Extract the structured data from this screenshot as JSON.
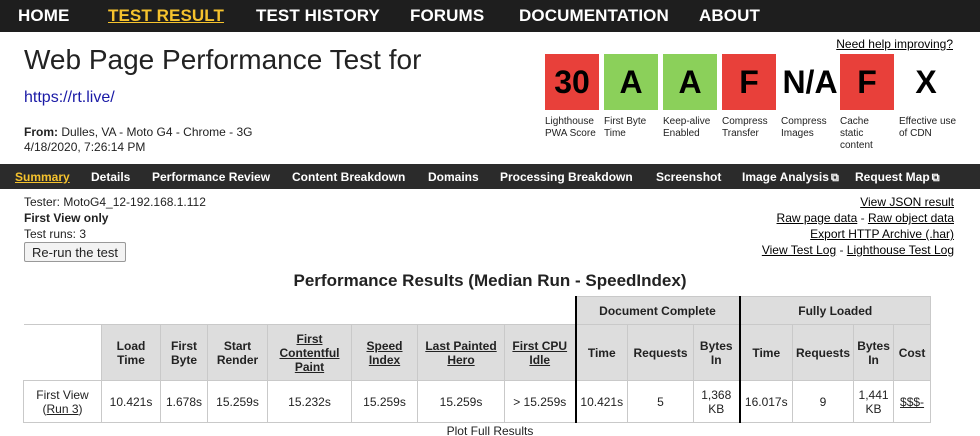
{
  "nav": {
    "items": [
      "HOME",
      "TEST RESULT",
      "TEST HISTORY",
      "FORUMS",
      "DOCUMENTATION",
      "ABOUT"
    ],
    "active": "TEST RESULT"
  },
  "header": {
    "title": "Web Page Performance Test for",
    "url": "https://rt.live/",
    "from_label": "From:",
    "from_value": "Dulles, VA - Moto G4 - Chrome - 3G",
    "date": "4/18/2020, 7:26:14 PM",
    "help_link": "Need help improving?"
  },
  "grades": [
    {
      "value": "30",
      "label": "Lighthouse PWA Score",
      "color": "#e8403a"
    },
    {
      "value": "A",
      "label": "First Byte Time",
      "color": "#8bd05a"
    },
    {
      "value": "A",
      "label": "Keep-alive Enabled",
      "color": "#8bd05a"
    },
    {
      "value": "F",
      "label": "Compress Transfer",
      "color": "#e8403a"
    },
    {
      "value": "N/A",
      "label": "Compress Images",
      "color": "#ffffff"
    },
    {
      "value": "F",
      "label": "Cache static content",
      "color": "#e8403a"
    },
    {
      "value": "X",
      "label": "Effective use of CDN",
      "color": "#ffffff"
    }
  ],
  "subnav": {
    "items": [
      "Summary",
      "Details",
      "Performance Review",
      "Content Breakdown",
      "Domains",
      "Processing Breakdown",
      "Screenshot",
      "Image Analysis",
      "Request Map"
    ],
    "active": "Summary"
  },
  "test_info": {
    "tester": "Tester: MotoG4_12-192.168.1.112",
    "view": "First View only",
    "runs": "Test runs: 3",
    "rerun_button": "Re-run the test"
  },
  "links": {
    "view_json": "View JSON result",
    "raw_page": "Raw page data",
    "raw_object": "Raw object data",
    "export_har": "Export HTTP Archive (.har)",
    "test_log": "View Test Log",
    "lighthouse_log": "Lighthouse Test Log",
    "separator": " - "
  },
  "results": {
    "heading": "Performance Results (Median Run - SpeedIndex)",
    "group_headers": {
      "document_complete": "Document Complete",
      "fully_loaded": "Fully Loaded"
    },
    "columns": {
      "load_time": "Load Time",
      "first_byte": "First Byte",
      "start_render": "Start Render",
      "fcp": "First Contentful Paint",
      "speed_index": "Speed Index",
      "lph": "Last Painted Hero",
      "cpu_idle": "First CPU Idle",
      "dc_time": "Time",
      "dc_requests": "Requests",
      "dc_bytes": "Bytes In",
      "fl_time": "Time",
      "fl_requests": "Requests",
      "fl_bytes": "Bytes In",
      "cost": "Cost"
    },
    "row": {
      "label": "First View",
      "run_link": "Run 3",
      "load_time": "10.421s",
      "first_byte": "1.678s",
      "start_render": "15.259s",
      "fcp": "15.232s",
      "speed_index": "15.259s",
      "lph": "15.259s",
      "cpu_idle": "> 15.259s",
      "dc_time": "10.421s",
      "dc_requests": "5",
      "dc_bytes": "1,368 KB",
      "fl_time": "16.017s",
      "fl_requests": "9",
      "fl_bytes": "1,441 KB",
      "cost": "$$$-"
    },
    "plot_link": "Plot Full Results"
  }
}
